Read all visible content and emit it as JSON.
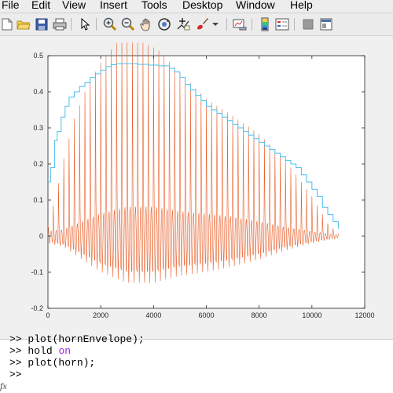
{
  "menu": {
    "items": [
      "File",
      "Edit",
      "View",
      "Insert",
      "Tools",
      "Desktop",
      "Window",
      "Help"
    ]
  },
  "toolbar": {
    "icons": [
      "new-figure-icon",
      "open-file-icon",
      "save-icon",
      "print-icon",
      "pointer-icon",
      "zoom-in-icon",
      "zoom-out-icon",
      "pan-icon",
      "rotate-icon",
      "data-cursor-icon",
      "brush-icon",
      "brush-dropdown-icon",
      "link-plot-icon",
      "colorbar-icon",
      "legend-icon",
      "hide-plot-tools-icon",
      "show-plot-tools-icon"
    ]
  },
  "colors": {
    "envelope": "#4dbeee",
    "signal": "#e8602c",
    "axes_bg": "#ffffff",
    "figure_bg": "#f0f0f0",
    "keyword": "#a020f0"
  },
  "chart_data": {
    "type": "line",
    "title": "",
    "xlabel": "",
    "ylabel": "",
    "xlim": [
      0,
      12000
    ],
    "ylim": [
      -0.2,
      0.5
    ],
    "x_ticks": [
      "0",
      "2000",
      "4000",
      "6000",
      "8000",
      "10000",
      "12000"
    ],
    "y_ticks": [
      "-0.2",
      "-0.1",
      "0",
      "0.1",
      "0.2",
      "0.3",
      "0.4",
      "0.5"
    ],
    "grid": false,
    "series": [
      {
        "color": "#4dbeee",
        "x": [
          0,
          100,
          250,
          350,
          500,
          650,
          800,
          1000,
          1200,
          1400,
          1600,
          1800,
          2000,
          2200,
          2400,
          2600,
          3000,
          3400,
          3800,
          4200,
          4600,
          4800,
          5000,
          5200,
          5400,
          5600,
          5800,
          6000,
          6200,
          6400,
          6600,
          6800,
          7000,
          7200,
          7400,
          7600,
          7800,
          8000,
          8200,
          8400,
          8600,
          8800,
          9000,
          9200,
          9400,
          9600,
          9800,
          10000,
          10200,
          10400,
          10600,
          10800,
          11000
        ],
        "y": [
          0.15,
          0.19,
          0.265,
          0.29,
          0.33,
          0.36,
          0.385,
          0.4,
          0.415,
          0.425,
          0.44,
          0.45,
          0.46,
          0.47,
          0.475,
          0.478,
          0.478,
          0.476,
          0.474,
          0.472,
          0.465,
          0.455,
          0.44,
          0.42,
          0.405,
          0.39,
          0.375,
          0.36,
          0.35,
          0.34,
          0.33,
          0.32,
          0.31,
          0.3,
          0.29,
          0.28,
          0.27,
          0.26,
          0.25,
          0.24,
          0.23,
          0.22,
          0.21,
          0.2,
          0.19,
          0.17,
          0.15,
          0.13,
          0.11,
          0.08,
          0.06,
          0.04,
          0.02
        ]
      },
      {
        "color": "#e8602c",
        "x_start": 0,
        "x_end": 11000,
        "period": 200,
        "fundamental_amplitude": [
          [
            0,
            0.02
          ],
          [
            300,
            0.1
          ],
          [
            600,
            0.2
          ],
          [
            1000,
            0.3
          ],
          [
            1500,
            0.38
          ],
          [
            2000,
            0.43
          ],
          [
            2600,
            0.475
          ],
          [
            3000,
            0.47
          ],
          [
            3600,
            0.47
          ],
          [
            4200,
            0.45
          ],
          [
            4800,
            0.41
          ],
          [
            5400,
            0.37
          ],
          [
            6000,
            0.33
          ],
          [
            7000,
            0.29
          ],
          [
            8000,
            0.25
          ],
          [
            9000,
            0.19
          ],
          [
            10000,
            0.1
          ],
          [
            10600,
            0.03
          ],
          [
            11000,
            0.005
          ]
        ],
        "harmonic_amplitude": [
          [
            0,
            0.02
          ],
          [
            600,
            0.03
          ],
          [
            1200,
            0.06
          ],
          [
            2000,
            0.1
          ],
          [
            3000,
            0.13
          ],
          [
            4000,
            0.13
          ],
          [
            5000,
            0.11
          ],
          [
            6000,
            0.1
          ],
          [
            7000,
            0.085
          ],
          [
            8000,
            0.065
          ],
          [
            9000,
            0.04
          ],
          [
            10000,
            0.02
          ],
          [
            11000,
            0.005
          ]
        ]
      }
    ]
  },
  "command_window": {
    "lines": [
      {
        "prompt": ">>",
        "text": "plot(hornEnvelope);"
      },
      {
        "prompt": ">>",
        "text": "hold ",
        "keyword": "on"
      },
      {
        "prompt": ">>",
        "text": "plot(horn);"
      },
      {
        "prompt": ">>",
        "text": ""
      }
    ],
    "fx_label": "fx"
  }
}
